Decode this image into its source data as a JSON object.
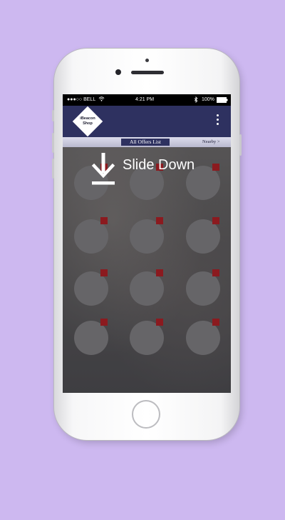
{
  "status_bar": {
    "carrier": "●●●○○ BELL",
    "wifi_icon": "wifi-icon",
    "time": "4:21 PM",
    "bluetooth_icon": "bluetooth-icon",
    "battery": "100%",
    "battery_icon": "battery-icon"
  },
  "nav_bar": {
    "logo_line1": "iBeacon",
    "logo_line2": "Shop",
    "menu_icon": "vertical-dots-icon",
    "background_color": "#2e3160"
  },
  "tabs": {
    "active_label": "All Offers List",
    "nearby_label": "Nearby >"
  },
  "overlay": {
    "icon": "download-arrow-icon",
    "label": "Slide Down"
  },
  "offers": {
    "count": 12,
    "badge_color": "#8b1a1f"
  }
}
